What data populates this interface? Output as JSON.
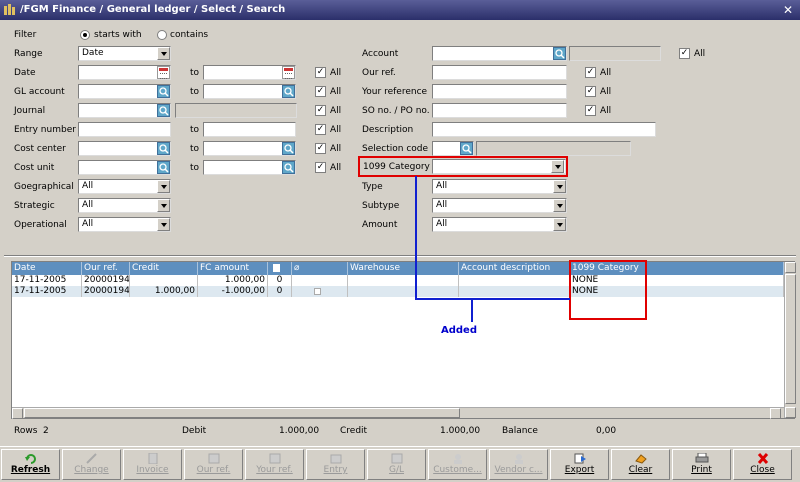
{
  "window": {
    "title": "/FGM  Finance / General ledger / Select / Search"
  },
  "filter": {
    "label": "Filter",
    "opt_starts": "starts with",
    "opt_contains": "contains"
  },
  "left_fields": {
    "range": {
      "label": "Range",
      "value": "Date"
    },
    "date": {
      "label": "Date",
      "to": "to",
      "all": "All"
    },
    "gl_account": {
      "label": "GL account",
      "to": "to",
      "all": "All"
    },
    "journal": {
      "label": "Journal",
      "all": "All"
    },
    "entry_number": {
      "label": "Entry number",
      "to": "to",
      "all": "All"
    },
    "cost_center": {
      "label": "Cost center",
      "to": "to",
      "all": "All"
    },
    "cost_unit": {
      "label": "Cost unit",
      "to": "to",
      "all": "All"
    },
    "geographical": {
      "label": "Goegraphical",
      "value": "All"
    },
    "strategic": {
      "label": "Strategic",
      "value": "All"
    },
    "operational": {
      "label": "Operational",
      "value": "All"
    }
  },
  "right_fields": {
    "account": {
      "label": "Account",
      "all": "All"
    },
    "our_ref": {
      "label": "Our ref.",
      "all": "All"
    },
    "your_reference": {
      "label": "Your reference",
      "all": "All"
    },
    "so_po": {
      "label": "SO no. / PO no.",
      "all": "All"
    },
    "description": {
      "label": "Description"
    },
    "selection_code": {
      "label": "Selection code"
    },
    "category_1099": {
      "label": "1099 Category",
      "value": ""
    },
    "type": {
      "label": "Type",
      "value": "All"
    },
    "subtype": {
      "label": "Subtype",
      "value": "All"
    },
    "amount": {
      "label": "Amount",
      "value": "All"
    }
  },
  "grid": {
    "headers": [
      "Date",
      "Our ref.",
      "Credit",
      "FC amount",
      "",
      "",
      "Warehouse",
      "Account description",
      "1099 Category"
    ],
    "rows": [
      {
        "date": "17-11-2005",
        "ref": "20000194",
        "credit": "",
        "fc": "1.000,00",
        "c5": "0",
        "wh": "",
        "desc": "",
        "cat": "NONE"
      },
      {
        "date": "17-11-2005",
        "ref": "20000194",
        "credit": "1.000,00",
        "fc": "-1.000,00",
        "c5": "0",
        "wh": "",
        "desc": "",
        "cat": "NONE"
      }
    ]
  },
  "annotation": {
    "text": "Added",
    "color": "#0000cc"
  },
  "totals": {
    "rows_label": "Rows",
    "rows_value": "2",
    "debit_label": "Debit",
    "debit_value": "1.000,00",
    "credit_label": "Credit",
    "credit_value": "1.000,00",
    "balance_label": "Balance",
    "balance_value": "0,00"
  },
  "toolbar": {
    "refresh": "Refresh",
    "change": "Change",
    "invoice": "Invoice",
    "our_ref": "Our ref.",
    "your_ref": "Your ref.",
    "entry": "Entry",
    "gl": "G/L",
    "customer": "Custome...",
    "vendor": "Vendor c...",
    "export": "Export",
    "clear": "Clear",
    "print": "Print",
    "close": "Close"
  },
  "colors": {
    "title_bar": "#2b2f6a",
    "grid_header": "#5e8fbf",
    "highlight_box": "#e00000",
    "selected_row": "#dde8f0"
  }
}
